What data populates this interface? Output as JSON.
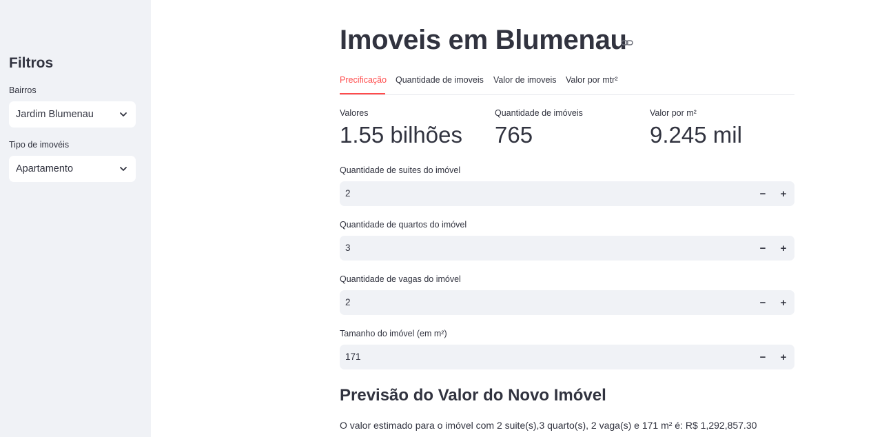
{
  "sidebar": {
    "title": "Filtros",
    "neighborhood": {
      "label": "Bairros",
      "value": "Jardim Blumenau"
    },
    "property_type": {
      "label": "Tipo de imovéis",
      "value": "Apartamento"
    }
  },
  "header": {
    "title": "Imoveis em Blumenau"
  },
  "tabs": [
    {
      "label": "Precificação",
      "active": true
    },
    {
      "label": "Quantidade de imoveis",
      "active": false
    },
    {
      "label": "Valor de imoveis",
      "active": false
    },
    {
      "label": "Valor por mtr²",
      "active": false
    }
  ],
  "metrics": [
    {
      "label": "Valores",
      "value": "1.55 bilhões"
    },
    {
      "label": "Quantidade de imóveis",
      "value": "765"
    },
    {
      "label": "Valor por m²",
      "value": "9.245 mil"
    }
  ],
  "inputs": [
    {
      "label": "Quantidade de suites do imóvel",
      "value": "2"
    },
    {
      "label": "Quantidade de quartos do imóvel",
      "value": "3"
    },
    {
      "label": "Quantidade de vagas do imóvel",
      "value": "2"
    },
    {
      "label": "Tamanho do imóvel (em m²)",
      "value": "171"
    }
  ],
  "stepper": {
    "minus": "−",
    "plus": "+"
  },
  "prediction": {
    "title": "Previsão do Valor do Novo Imóvel",
    "text": "O valor estimado para o imóvel com 2 suite(s),3 quarto(s), 2 vaga(s) e 171 m² é: R$ 1,292,857.30"
  },
  "colors": {
    "accent": "#ff4b4b",
    "sidebar_bg": "#f0f2f6",
    "text": "#31333f"
  }
}
